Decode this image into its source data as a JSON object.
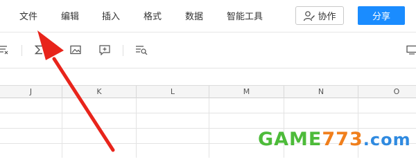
{
  "menu": {
    "items": [
      {
        "key": "file",
        "label": "文件"
      },
      {
        "key": "edit",
        "label": "编辑"
      },
      {
        "key": "insert",
        "label": "插入"
      },
      {
        "key": "format",
        "label": "格式"
      },
      {
        "key": "data",
        "label": "数据"
      },
      {
        "key": "smart_tools",
        "label": "智能工具"
      }
    ],
    "collab_label": "协作",
    "share_label": "分享"
  },
  "toolbar": {
    "icons": [
      "clear-format-icon",
      "sum-icon",
      "image-icon",
      "comment-icon",
      "filter-icon",
      "freeze-icon"
    ]
  },
  "grid": {
    "columns": [
      "J",
      "K",
      "L",
      "M",
      "N",
      "O"
    ]
  },
  "watermark": {
    "game": "GAME",
    "num": "773",
    "dom": ".com"
  },
  "colors": {
    "accent": "#1a8cff",
    "arrow": "#e8241b"
  }
}
